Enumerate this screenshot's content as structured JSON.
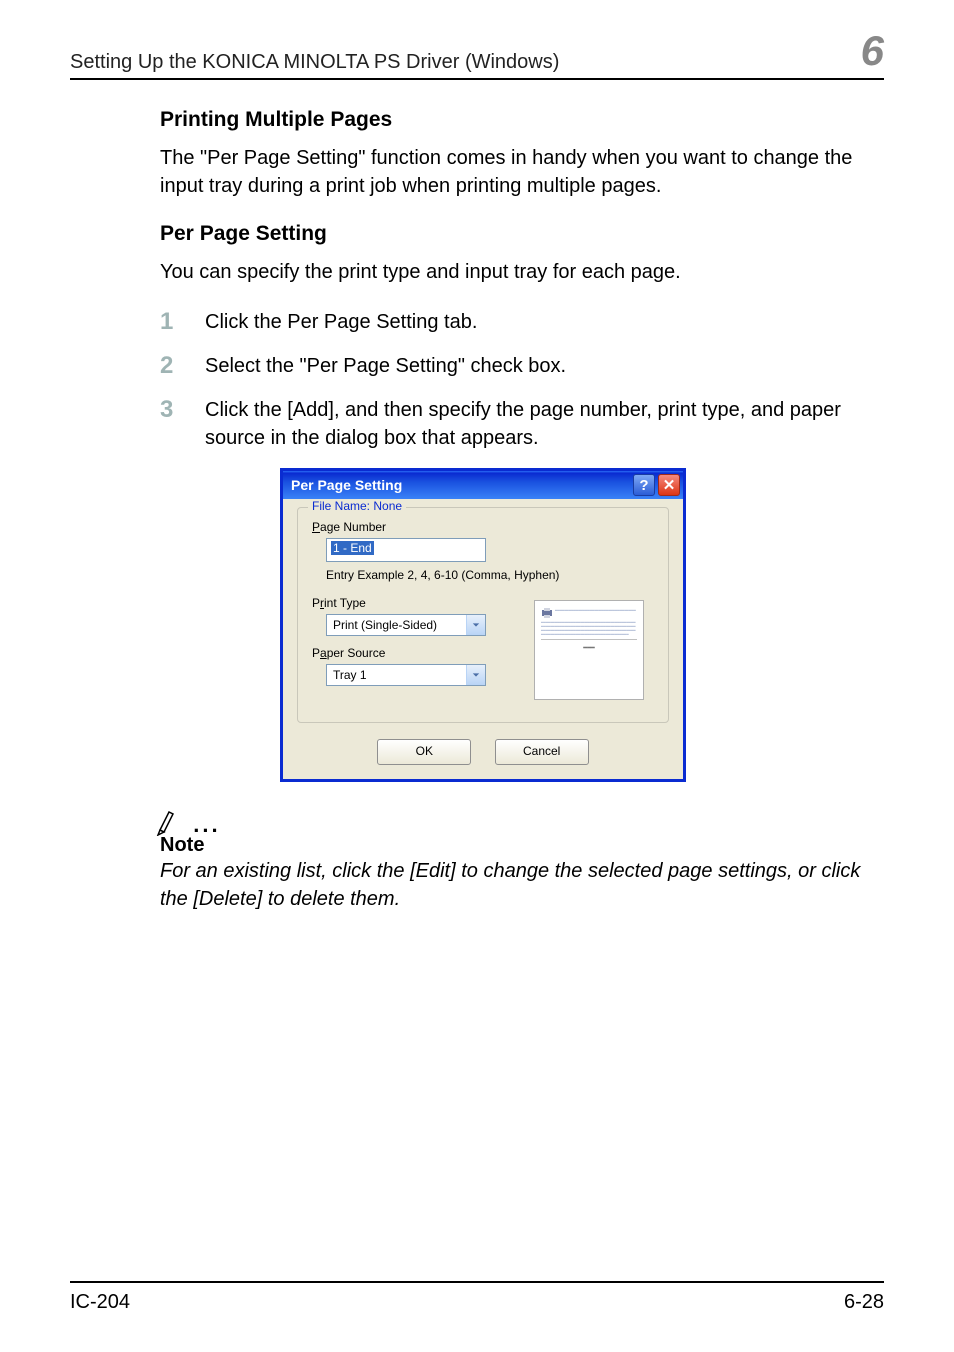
{
  "header": {
    "running": "Setting Up the KONICA MINOLTA PS Driver (Windows)",
    "chapter": "6"
  },
  "section": {
    "title1": "Printing Multiple Pages",
    "para1": "The \"Per Page Setting\" function comes in handy when you want to change the input tray during a print job when printing multiple pages.",
    "title2": "Per Page Setting",
    "para2": "You can specify the print type and input tray for each page."
  },
  "steps": [
    {
      "num": "1",
      "text": "Click the Per Page Setting tab."
    },
    {
      "num": "2",
      "text": "Select the \"Per Page Setting\" check box."
    },
    {
      "num": "3",
      "text": "Click the [Add], and then specify the page number, print type, and paper source in the dialog box that appears."
    }
  ],
  "dialog": {
    "title": "Per Page Setting",
    "group_legend": "File Name: None",
    "labels": {
      "page_number": "Page Number",
      "entry_helper": "Entry Example 2, 4, 6-10 (Comma, Hyphen)",
      "print_type": "Print Type",
      "paper_source": "Paper Source"
    },
    "values": {
      "page_number": "1 - End",
      "print_type": "Print (Single-Sided)",
      "paper_source": "Tray 1"
    },
    "buttons": {
      "ok": "OK",
      "cancel": "Cancel"
    },
    "title_buttons": {
      "help": "?",
      "close": "✕"
    }
  },
  "note": {
    "label": "Note",
    "text": "For an existing list, click the [Edit] to change the selected page settings, or click the [Delete] to delete them."
  },
  "footer": {
    "left": "IC-204",
    "right": "6-28"
  }
}
